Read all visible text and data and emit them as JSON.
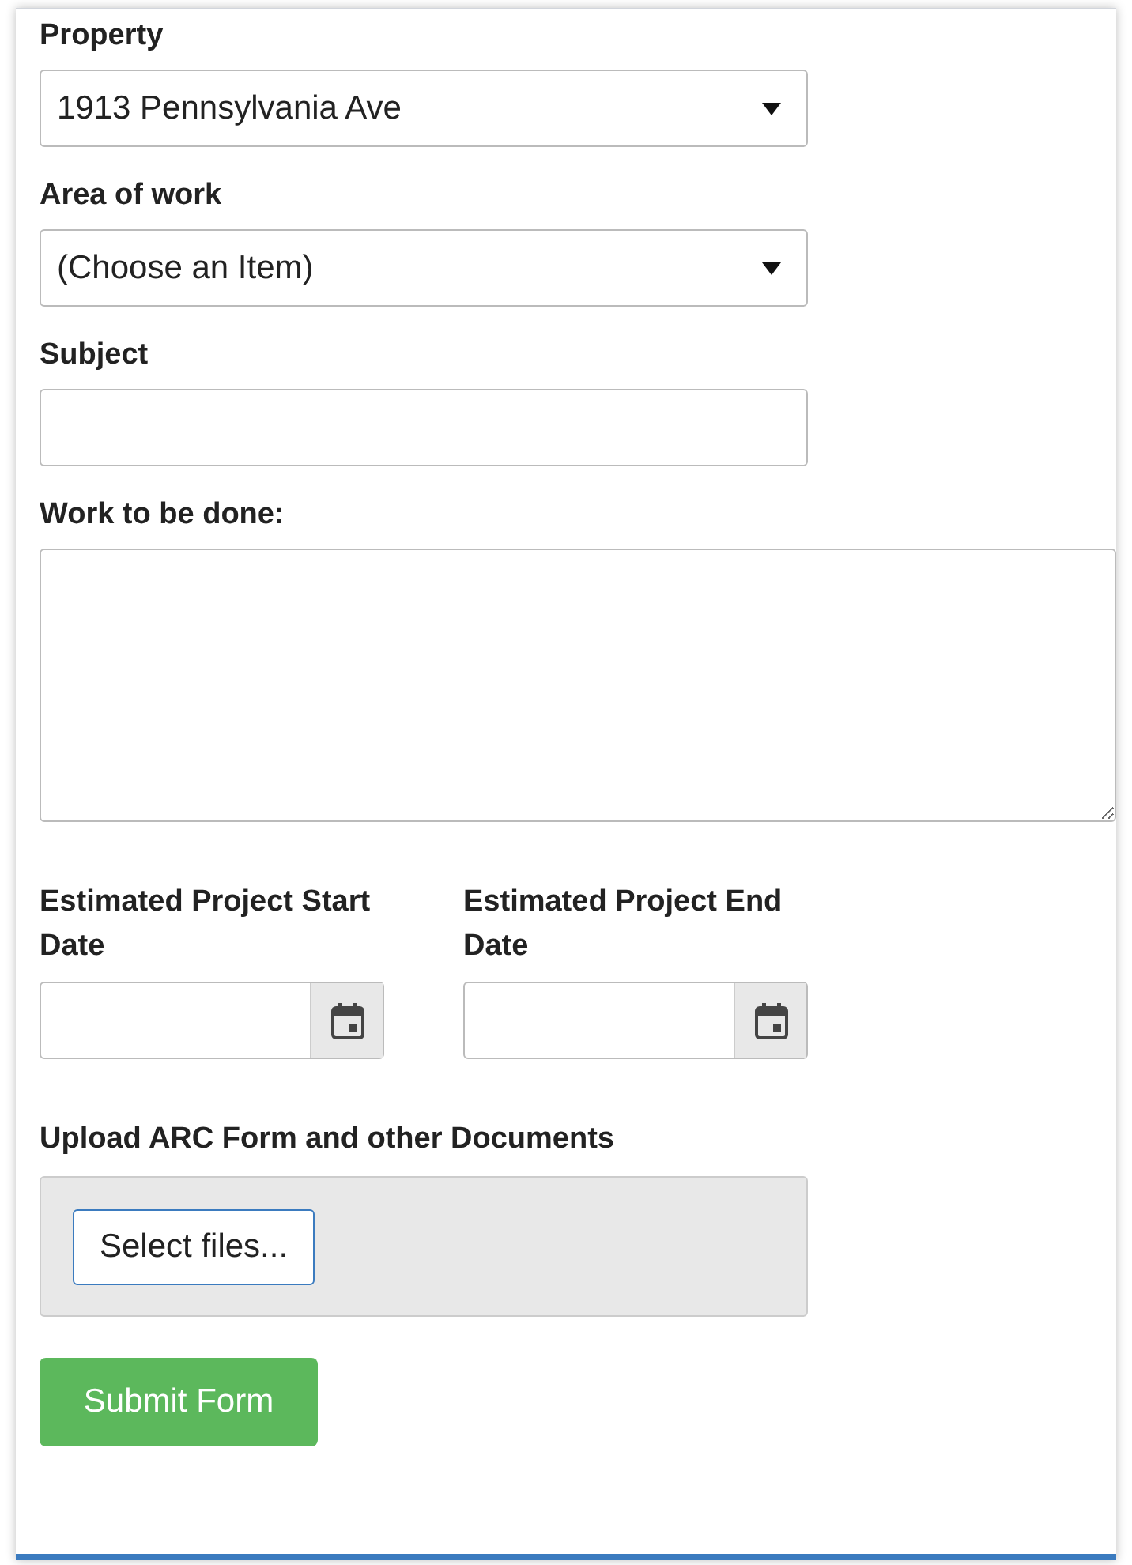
{
  "fields": [
    {
      "kind": "select",
      "label": "Property",
      "value": "1913 Pennsylvania Ave"
    },
    {
      "kind": "select",
      "label": "Area of work",
      "value": "(Choose an Item)"
    },
    {
      "kind": "text",
      "label": "Subject"
    },
    {
      "kind": "textarea",
      "label": "Work to be done:"
    }
  ],
  "dates": [
    {
      "label": "Estimated Project Start Date"
    },
    {
      "label": "Estimated Project End Date"
    }
  ],
  "upload": {
    "label": "Upload ARC Form and other Documents",
    "button": "Select files..."
  },
  "submit": "Submit Form"
}
